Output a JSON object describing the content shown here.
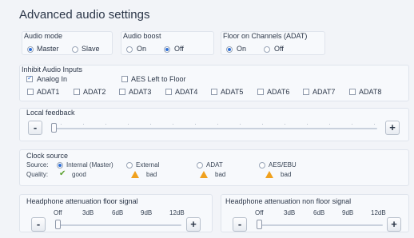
{
  "title": "Advanced audio settings",
  "audio_mode": {
    "label": "Audio mode",
    "options": [
      "Master",
      "Slave"
    ],
    "selected": "Master"
  },
  "audio_boost": {
    "label": "Audio boost",
    "options": [
      "On",
      "Off"
    ],
    "selected": "Off"
  },
  "floor_on_channels": {
    "label": "Floor on Channels (ADAT)",
    "options": [
      "On",
      "Off"
    ],
    "selected": "On"
  },
  "inhibit": {
    "label": "Inhibit Audio Inputs",
    "analog_in": "Analog In",
    "aes_left_to_floor": "AES Left to Floor",
    "adat": [
      "ADAT1",
      "ADAT2",
      "ADAT3",
      "ADAT4",
      "ADAT5",
      "ADAT6",
      "ADAT7",
      "ADAT8"
    ],
    "analog_checked": true
  },
  "local_feedback": {
    "label": "Local feedback",
    "value_fraction": 0.0,
    "minus": "-",
    "plus": "+"
  },
  "clock_source": {
    "label": "Clock source",
    "source_label": "Source:",
    "quality_label": "Quality:",
    "options": [
      "Internal (Master)",
      "External",
      "ADAT",
      "AES/EBU"
    ],
    "selected": "Internal (Master)",
    "qualities": [
      "good",
      "bad",
      "bad",
      "bad"
    ]
  },
  "hp_floor": {
    "label": "Headphone attenuation floor signal",
    "ticks": [
      "Off",
      "3dB",
      "6dB",
      "9dB",
      "12dB"
    ],
    "value_fraction": 0.0,
    "minus": "-",
    "plus": "+"
  },
  "hp_non_floor": {
    "label": "Headphone attenuation non floor signal",
    "ticks": [
      "Off",
      "3dB",
      "6dB",
      "9dB",
      "12dB"
    ],
    "value_fraction": 0.0,
    "minus": "-",
    "plus": "+"
  }
}
